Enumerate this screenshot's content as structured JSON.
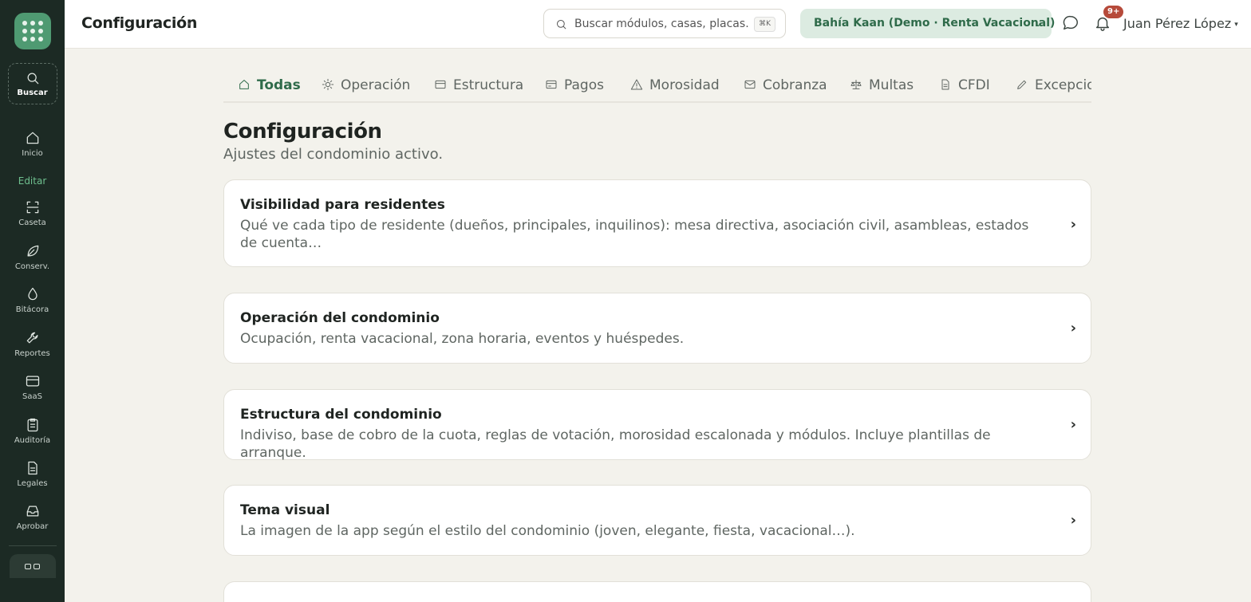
{
  "sidebar": {
    "search_label": "Buscar",
    "edit_label": "Editar",
    "items": [
      {
        "label": "Inicio",
        "icon": "home-icon"
      },
      {
        "label": "Caseta",
        "icon": "scan-icon"
      },
      {
        "label": "Conserv.",
        "icon": "leaf-icon"
      },
      {
        "label": "Bitácora",
        "icon": "drop-icon"
      },
      {
        "label": "Reportes",
        "icon": "wrench-icon"
      },
      {
        "label": "SaaS",
        "icon": "card-icon"
      },
      {
        "label": "Auditoría",
        "icon": "clipboard-icon"
      },
      {
        "label": "Legales",
        "icon": "document-icon"
      },
      {
        "label": "Aprobar",
        "icon": "inbox-icon"
      }
    ]
  },
  "header": {
    "title": "Configuración",
    "search_placeholder": "Buscar módulos, casas, placas…",
    "search_shortcut": "⌘K",
    "condo": "Bahía Kaan (Demo · Renta Vacacional)",
    "notifications_badge": "9+",
    "user_name": "Juan Pérez López"
  },
  "tabs": [
    {
      "label": "Todas",
      "icon": "home-icon",
      "active": true
    },
    {
      "label": "Operación",
      "icon": "sun-icon"
    },
    {
      "label": "Estructura",
      "icon": "card-icon"
    },
    {
      "label": "Pagos",
      "icon": "card-icon"
    },
    {
      "label": "Morosidad",
      "icon": "warning-icon"
    },
    {
      "label": "Cobranza",
      "icon": "mail-icon"
    },
    {
      "label": "Multas",
      "icon": "scale-icon"
    },
    {
      "label": "CFDI",
      "icon": "document-icon"
    },
    {
      "label": "Excepcio",
      "icon": "pencil-icon"
    }
  ],
  "page": {
    "title": "Configuración",
    "subtitle": "Ajustes del condominio activo."
  },
  "cards": [
    {
      "title": "Visibilidad para residentes",
      "description": "Qué ve cada tipo de residente (dueños, principales, inquilinos): mesa directiva, asociación civil, asambleas, estados de cuenta…"
    },
    {
      "title": "Operación del condominio",
      "description": "Ocupación, renta vacacional, zona horaria, eventos y huéspedes."
    },
    {
      "title": "Estructura del condominio",
      "description": "Indiviso, base de cobro de la cuota, reglas de votación, morosidad escalonada y módulos. Incluye plantillas de arranque."
    },
    {
      "title": "Tema visual",
      "description": "La imagen de la app según el estilo del condominio (joven, elegante, fiesta, vacacional…)."
    }
  ],
  "colors": {
    "sidebar_bg": "#1c2a24",
    "accent": "#2f6b4a",
    "page_bg": "#f3f2ec",
    "badge": "#b64a3a"
  }
}
